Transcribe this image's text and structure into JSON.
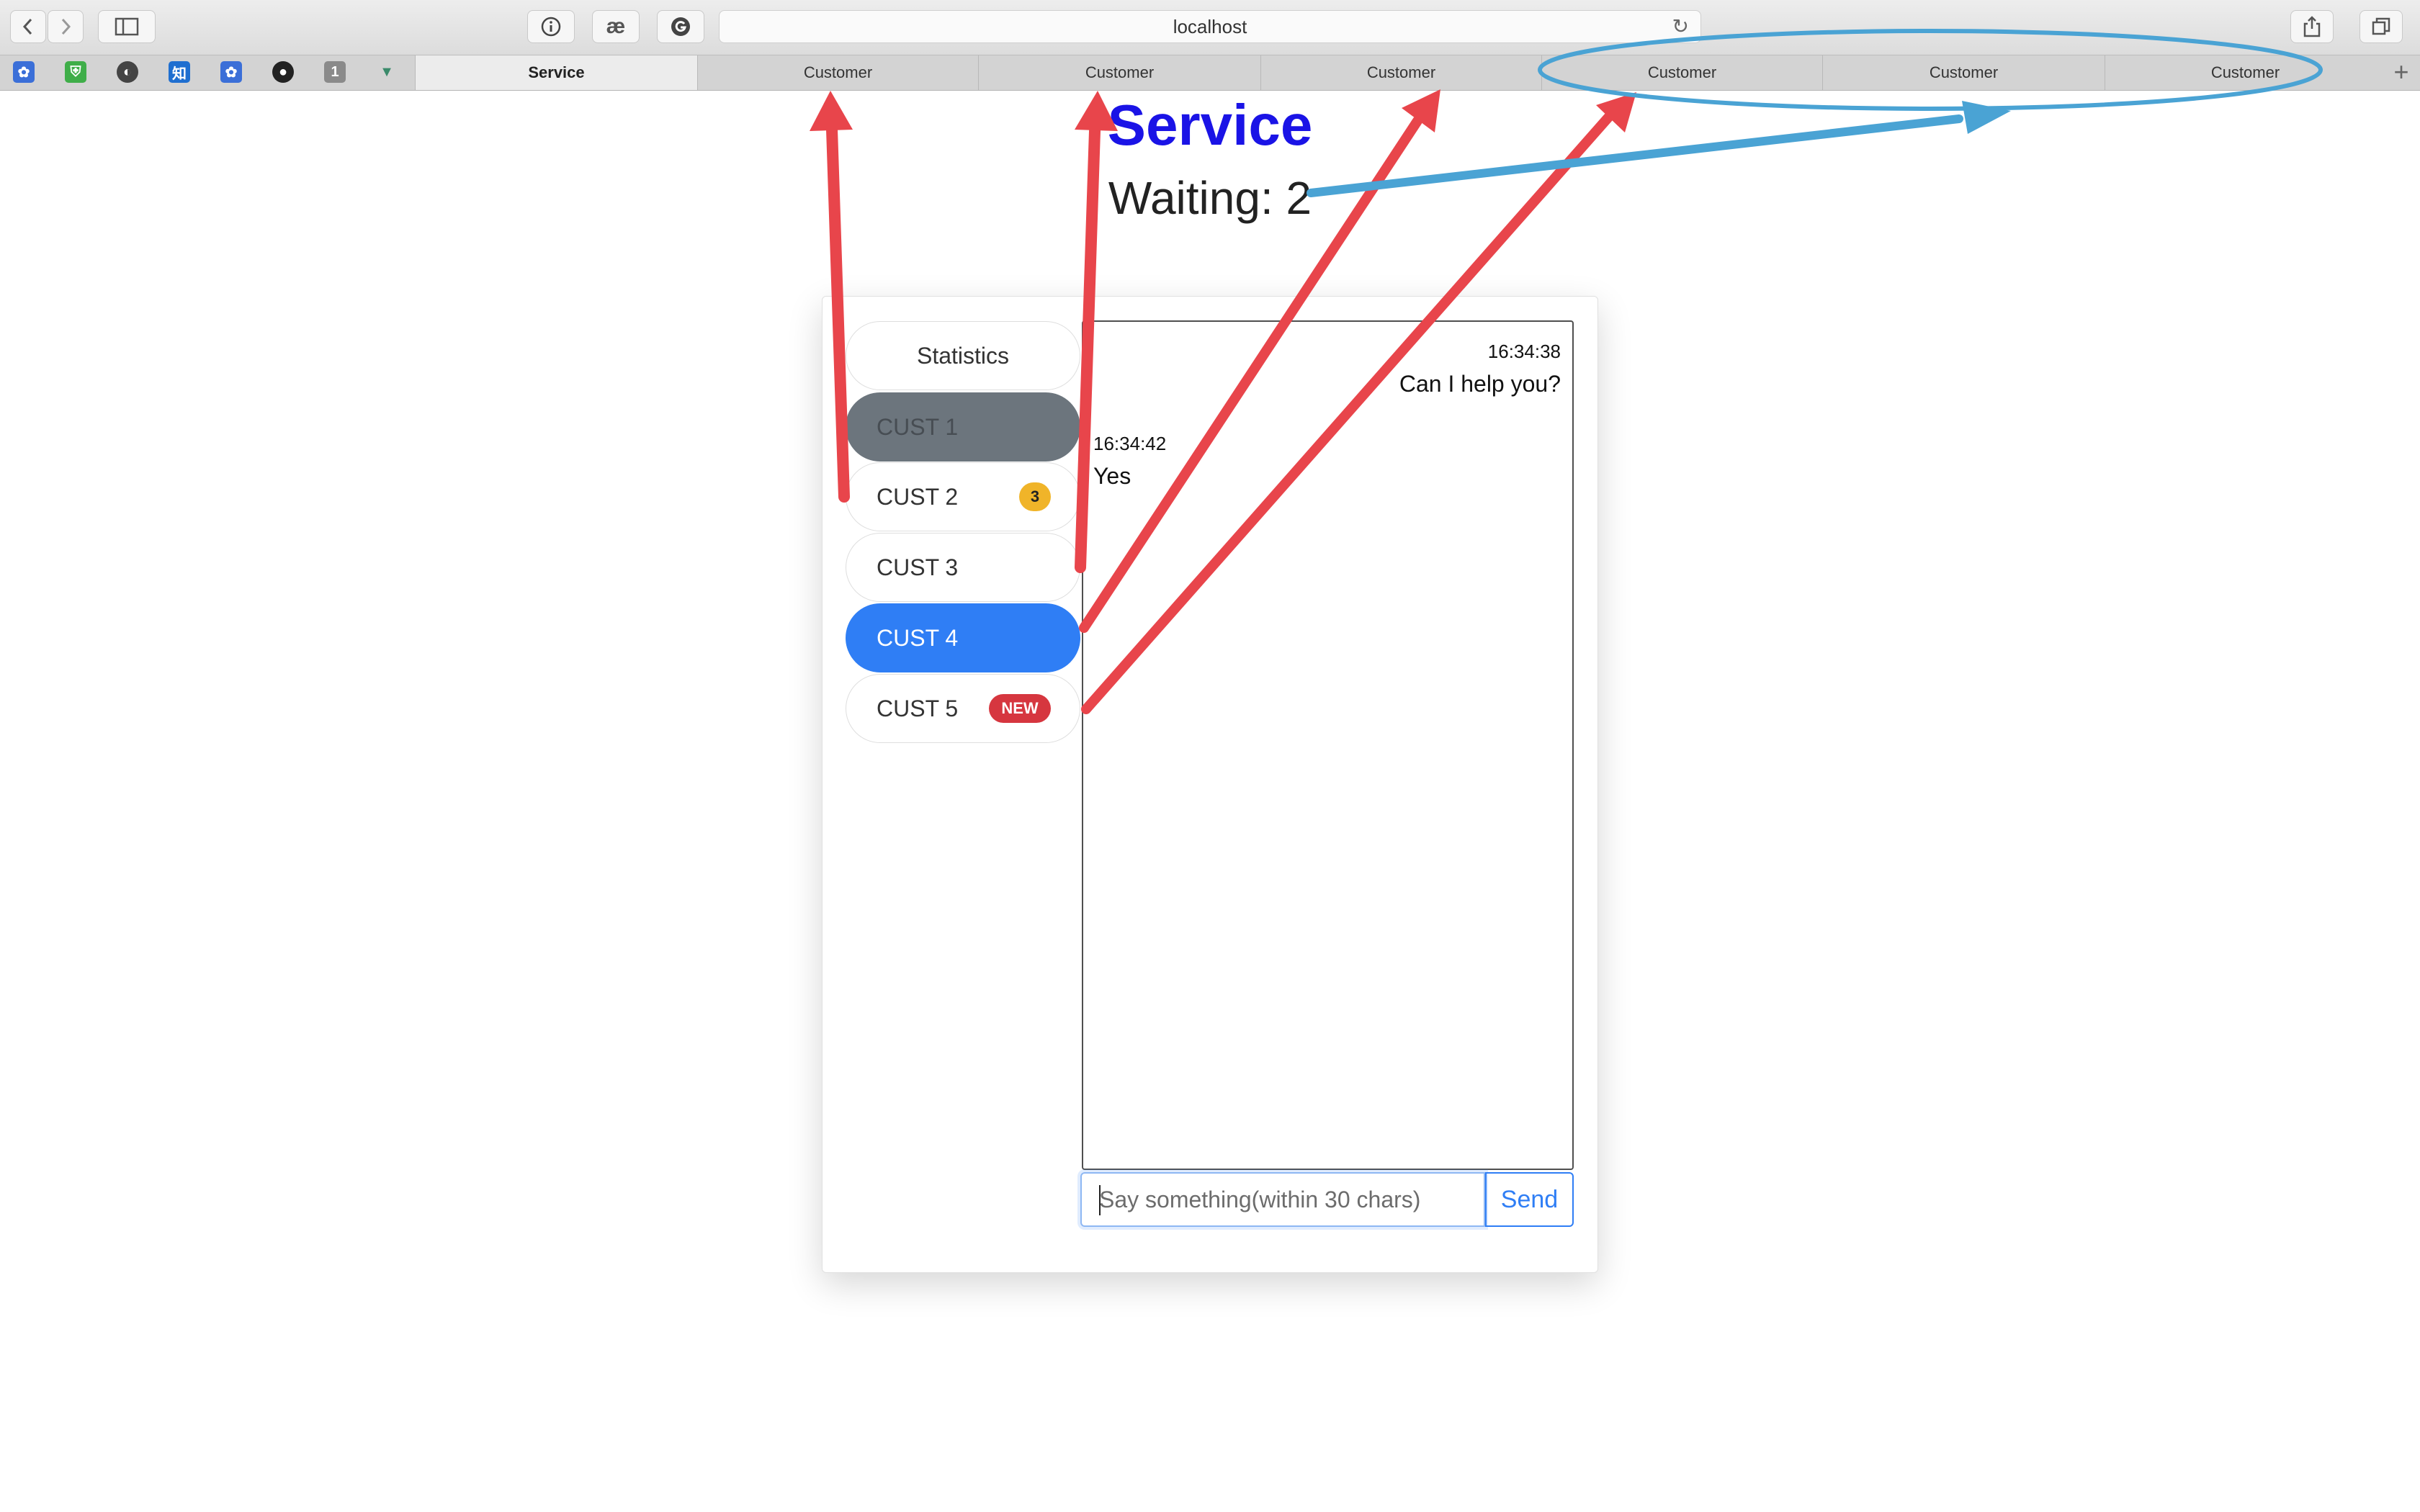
{
  "browser": {
    "url": "localhost",
    "tabs": [
      {
        "label": "Service",
        "active": true
      },
      {
        "label": "Customer"
      },
      {
        "label": "Customer"
      },
      {
        "label": "Customer"
      },
      {
        "label": "Customer"
      },
      {
        "label": "Customer"
      },
      {
        "label": "Customer"
      }
    ],
    "favorites": [
      "paw-icon",
      "shield-icon",
      "refresh-circle-icon",
      "zhihu-icon",
      "paw-icon",
      "github-icon",
      "one-icon",
      "vue-icon"
    ],
    "zhihu_glyph": "知",
    "one_glyph": "1"
  },
  "page": {
    "title": "Service",
    "waiting": "Waiting: 2"
  },
  "sidebar": {
    "statistics": "Statistics",
    "customers": [
      {
        "label": "CUST 1",
        "state": "selected-grey"
      },
      {
        "label": "CUST 2",
        "badge": "3"
      },
      {
        "label": "CUST 3"
      },
      {
        "label": "CUST 4",
        "state": "active"
      },
      {
        "label": "CUST 5",
        "badge": "NEW"
      }
    ]
  },
  "chat": {
    "messages": [
      {
        "time": "16:34:38",
        "text": "Can I help you?",
        "side": "right"
      },
      {
        "time": "16:34:42",
        "text": "Yes",
        "side": "left"
      }
    ]
  },
  "composer": {
    "placeholder": "Say something(within 30 chars)",
    "send_label": "Send"
  },
  "annotation_colors": {
    "red_arrow": "#e8454b",
    "blue_arrow": "#4aa3d4",
    "title_blue": "#1a13e6",
    "active_blue": "#2f7ef5"
  }
}
